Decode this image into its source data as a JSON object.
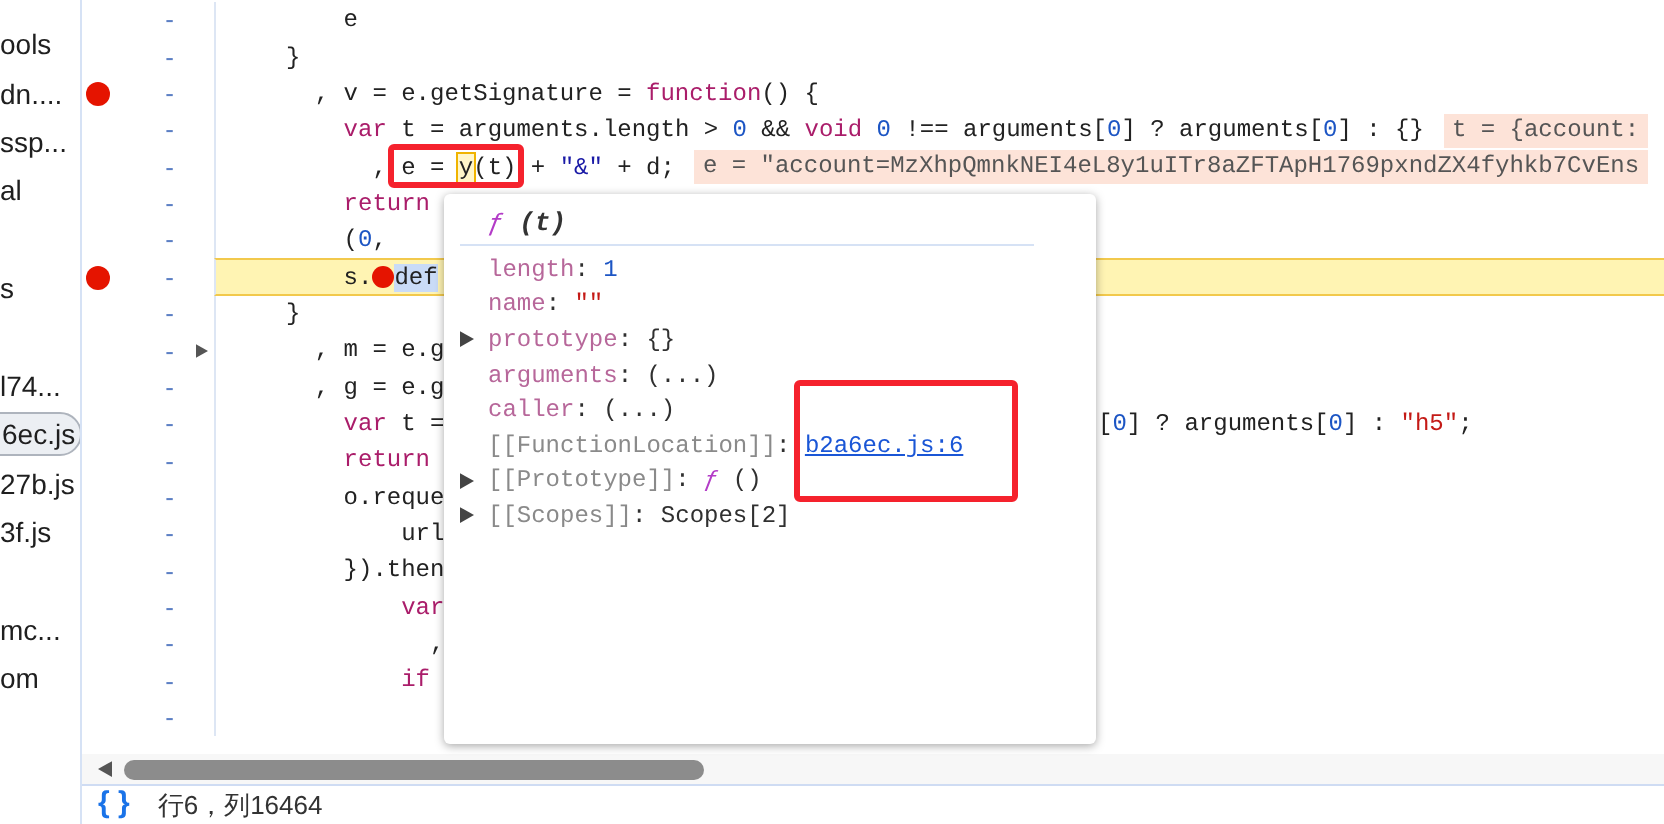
{
  "sidebar": {
    "items": [
      {
        "kind": "file",
        "label": "ools",
        "selected": false
      },
      {
        "kind": "file",
        "label": "dn....",
        "selected": false
      },
      {
        "kind": "file",
        "label": "ssp...",
        "selected": false
      },
      {
        "kind": "file",
        "label": "al",
        "selected": false
      },
      {
        "kind": "spacer"
      },
      {
        "kind": "file",
        "label": "s",
        "selected": false
      },
      {
        "kind": "spacer"
      },
      {
        "kind": "file",
        "label": "l74...",
        "selected": false
      },
      {
        "kind": "file",
        "label": "6ec.js",
        "selected": true
      },
      {
        "kind": "file",
        "label": "27b.js",
        "selected": false
      },
      {
        "kind": "file",
        "label": "3f.js",
        "selected": false
      },
      {
        "kind": "spacer"
      },
      {
        "kind": "file",
        "label": "mc...",
        "selected": false
      },
      {
        "kind": "file",
        "label": "om",
        "selected": false
      }
    ]
  },
  "editor": {
    "lines": [
      {
        "marker": "-",
        "breakpoint": false,
        "paused": false,
        "foldable": false,
        "tokens": [
          {
            "text": "    e"
          }
        ]
      },
      {
        "marker": "-",
        "breakpoint": false,
        "paused": false,
        "foldable": false,
        "tokens": [
          {
            "text": "}"
          }
        ]
      },
      {
        "marker": "-",
        "breakpoint": true,
        "paused": false,
        "foldable": false,
        "tokens": [
          {
            "text": "  , v = e.getSignature = "
          },
          {
            "kw": "function"
          },
          {
            "text": "() {"
          }
        ]
      },
      {
        "marker": "-",
        "breakpoint": false,
        "paused": false,
        "foldable": false,
        "tokens": [
          {
            "kw": "    var"
          },
          {
            "text": " t = arguments.length > "
          },
          {
            "num": "0"
          },
          {
            "text": " && "
          },
          {
            "kw": "void"
          },
          {
            "num": " 0"
          },
          {
            "text": " !== arguments["
          },
          {
            "num": "0"
          },
          {
            "text": "] ? arguments["
          },
          {
            "num": "0"
          },
          {
            "text": "] : {}"
          }
        ],
        "inline_value": "t = {account:"
      },
      {
        "marker": "-",
        "breakpoint": false,
        "paused": false,
        "foldable": false,
        "tokens": [
          {
            "text": "      , "
          },
          {
            "text": "e = ",
            "frame": true
          },
          {
            "hover": "y",
            "frame": true
          },
          {
            "text": "(t)",
            "frame": true
          },
          {
            "text": " + "
          },
          {
            "lit": "\"&\""
          },
          {
            "text": " + d;"
          }
        ],
        "inline_value": "e = \"account=MzXhpQmnkNEI4eL8y1uITr8aZFTApH1769pxndZX4fyhkb7CvEns"
      },
      {
        "marker": "-",
        "breakpoint": false,
        "paused": false,
        "foldable": false,
        "tokens": [
          {
            "kw": "    return"
          }
        ]
      },
      {
        "marker": "-",
        "breakpoint": false,
        "paused": false,
        "foldable": false,
        "tokens": [
          {
            "text": "    ("
          },
          {
            "num": "0"
          },
          {
            "text": ","
          }
        ]
      },
      {
        "marker": "-",
        "breakpoint": true,
        "paused": true,
        "foldable": false,
        "tokens": [
          {
            "text": "    s."
          },
          {
            "breakpoint": true
          },
          {
            "sel": "def"
          }
        ]
      },
      {
        "marker": "-",
        "breakpoint": false,
        "paused": false,
        "foldable": false,
        "tokens": [
          {
            "text": "}"
          }
        ]
      },
      {
        "marker": "-",
        "breakpoint": false,
        "paused": false,
        "foldable": true,
        "tokens": [
          {
            "text": "  , m = e.g"
          }
        ]
      },
      {
        "marker": "-",
        "breakpoint": false,
        "paused": false,
        "foldable": false,
        "tokens": [
          {
            "text": "  , g = e.g"
          }
        ]
      },
      {
        "marker": "-",
        "breakpoint": false,
        "paused": false,
        "foldable": false,
        "tokens": [
          {
            "kw": "    var"
          },
          {
            "text": " t ="
          }
        ],
        "tail": [
          {
            "text": "["
          },
          {
            "num": "0"
          },
          {
            "text": "] ? arguments["
          },
          {
            "num": "0"
          },
          {
            "text": "] : "
          },
          {
            "str": "\"h5\""
          },
          {
            "text": ";"
          }
        ]
      },
      {
        "marker": "-",
        "breakpoint": false,
        "paused": false,
        "foldable": false,
        "tokens": [
          {
            "kw": "    return"
          }
        ]
      },
      {
        "marker": "-",
        "breakpoint": false,
        "paused": false,
        "foldable": false,
        "tokens": [
          {
            "text": "    o.reque"
          }
        ]
      },
      {
        "marker": "-",
        "breakpoint": false,
        "paused": false,
        "foldable": false,
        "tokens": [
          {
            "text": "        url"
          }
        ]
      },
      {
        "marker": "-",
        "breakpoint": false,
        "paused": false,
        "foldable": false,
        "tokens": [
          {
            "text": "    }).then"
          }
        ]
      },
      {
        "marker": "-",
        "breakpoint": false,
        "paused": false,
        "foldable": false,
        "tokens": [
          {
            "kw": "        var"
          }
        ]
      },
      {
        "marker": "-",
        "breakpoint": false,
        "paused": false,
        "foldable": false,
        "tokens": [
          {
            "text": "          ,"
          }
        ]
      },
      {
        "marker": "-",
        "breakpoint": false,
        "paused": false,
        "foldable": false,
        "tokens": [
          {
            "kw": "        if"
          }
        ]
      },
      {
        "marker": "-",
        "breakpoint": false,
        "paused": false,
        "foldable": false
      }
    ]
  },
  "popup": {
    "header": [
      {
        "fn": "ƒ"
      },
      {
        "head": " (t)"
      }
    ],
    "props": [
      {
        "expandable": false,
        "tokens": [
          {
            "prop": "length"
          },
          {
            "text": ": "
          },
          {
            "num": "1"
          }
        ]
      },
      {
        "expandable": false,
        "tokens": [
          {
            "prop": "name"
          },
          {
            "text": ": "
          },
          {
            "str": "\"\""
          }
        ]
      },
      {
        "expandable": true,
        "tokens": [
          {
            "prop": "prototype"
          },
          {
            "text": ": {}"
          }
        ]
      },
      {
        "expandable": false,
        "tokens": [
          {
            "prop": "arguments"
          },
          {
            "text": ": (...)"
          }
        ]
      },
      {
        "expandable": false,
        "tokens": [
          {
            "prop": "caller"
          },
          {
            "text": ": (...)"
          }
        ]
      },
      {
        "expandable": false,
        "tokens": [
          {
            "internal": "[[FunctionLocation]]"
          },
          {
            "text": ": "
          },
          {
            "link": "b2a6ec.js:6",
            "frame": true
          }
        ]
      },
      {
        "expandable": true,
        "tokens": [
          {
            "internal": "[[Prototype]]"
          },
          {
            "text": ": "
          },
          {
            "fn": "ƒ"
          },
          {
            "text": " ()"
          }
        ]
      },
      {
        "expandable": true,
        "tokens": [
          {
            "internal": "[[Scopes]]"
          },
          {
            "text": ": Scopes[2]"
          }
        ]
      }
    ]
  },
  "status_bar": {
    "format_icon": "{ }",
    "position": "行6，列16464"
  }
}
